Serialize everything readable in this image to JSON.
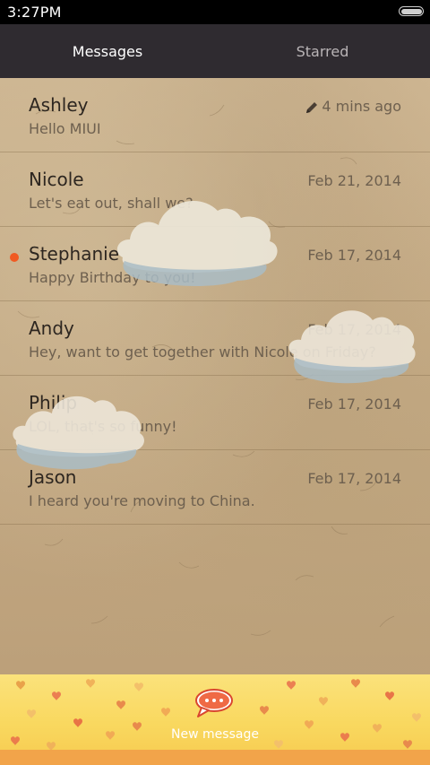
{
  "status_bar": {
    "time": "3:27PM"
  },
  "tabs": [
    {
      "label": "Messages",
      "active": true
    },
    {
      "label": "Starred",
      "active": false
    }
  ],
  "threads": [
    {
      "contact": "Ashley",
      "preview": "Hello MIUI",
      "date": "4 mins ago",
      "draft": true,
      "unread": false
    },
    {
      "contact": "Nicole",
      "preview": "Let's eat out, shall we?",
      "date": "Feb 21, 2014",
      "draft": false,
      "unread": false
    },
    {
      "contact": "Stephanie",
      "preview": "Happy Birthday to you!",
      "date": "Feb 17, 2014",
      "draft": false,
      "unread": true
    },
    {
      "contact": "Andy",
      "preview": "Hey, want to get together with Nicole on Friday?",
      "date": "Feb 17, 2014",
      "draft": false,
      "unread": false
    },
    {
      "contact": "Philip",
      "preview": "LOL, that's so funny!",
      "date": "Feb 17, 2014",
      "draft": false,
      "unread": false
    },
    {
      "contact": "Jason",
      "preview": "I heard you're moving to China.",
      "date": "Feb 17, 2014",
      "draft": false,
      "unread": false
    }
  ],
  "bottom_bar": {
    "new_message_label": "New message",
    "icon": "speech-bubble-icon"
  },
  "colors": {
    "accent_unread": "#f05a22",
    "tab_bar": "#2f2b30",
    "paper": "#c9b08b",
    "bottom_bar": "#f9d85f"
  }
}
